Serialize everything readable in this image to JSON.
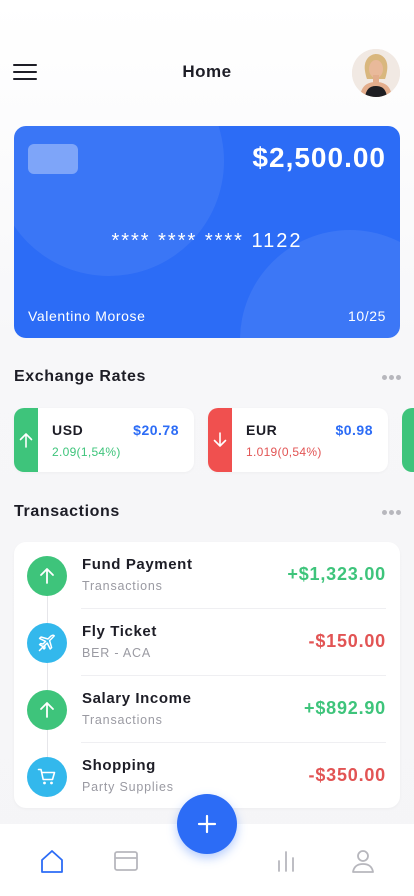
{
  "header": {
    "title": "Home"
  },
  "card": {
    "balance": "$2,500.00",
    "number": "**** **** **** 1122",
    "holder": "Valentino Morose",
    "expiry": "10/25",
    "color": "#2c6cf6"
  },
  "exchange": {
    "title": "Exchange Rates",
    "rates": [
      {
        "code": "USD",
        "value": "$20.78",
        "change": "2.09(1,54%)",
        "trend": "up",
        "color": "#3ec47b"
      },
      {
        "code": "EUR",
        "value": "$0.98",
        "change": "1.019(0,54%)",
        "trend": "down",
        "color": "#f0504f"
      }
    ]
  },
  "transactions": {
    "title": "Transactions",
    "items": [
      {
        "title": "Fund Payment",
        "subtitle": "Transactions",
        "amount": "+$1,323.00",
        "icon": "arrow-up-icon",
        "color": "#3ec47b"
      },
      {
        "title": "Fly Ticket",
        "subtitle": "BER - ACA",
        "amount": "-$150.00",
        "icon": "airplane-icon",
        "color": "#e25454"
      },
      {
        "title": "Salary Income",
        "subtitle": "Transactions",
        "amount": "+$892.90",
        "icon": "arrow-up-icon",
        "color": "#3ec47b"
      },
      {
        "title": "Shopping",
        "subtitle": "Party Supplies",
        "amount": "-$350.00",
        "icon": "cart-icon",
        "color": "#e25454"
      }
    ]
  },
  "nav": {
    "items": [
      "home-icon",
      "card-icon",
      "stats-icon",
      "profile-icon"
    ],
    "active": "home-icon"
  },
  "colors": {
    "accent": "#2c6cf6",
    "positive": "#3ec47b",
    "negative": "#e25454",
    "info": "#33b8ec"
  }
}
